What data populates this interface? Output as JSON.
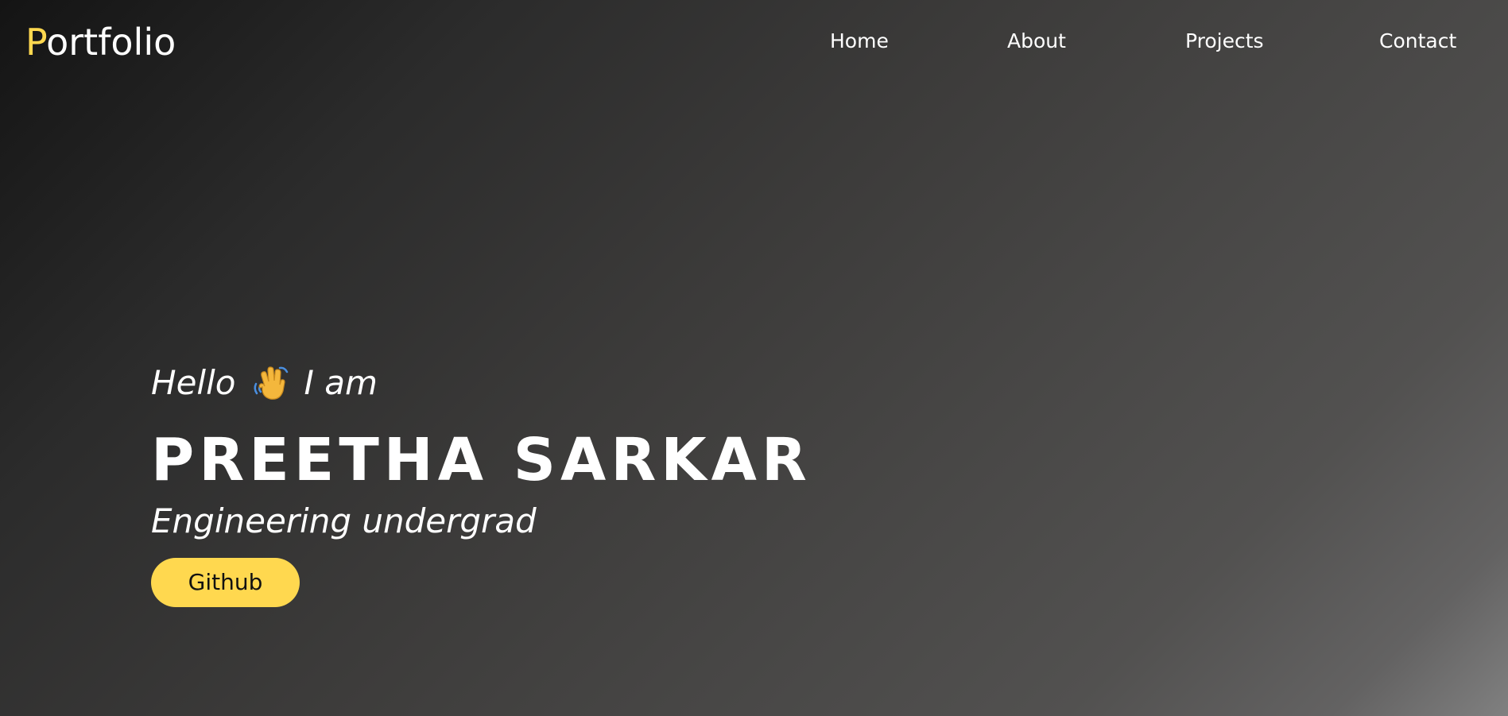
{
  "header": {
    "logo_accent": "P",
    "logo_rest": "ortfolio",
    "nav": {
      "home": "Home",
      "about": "About",
      "projects": "Projects",
      "contact": "Contact"
    }
  },
  "hero": {
    "greeting_before": "Hello",
    "greeting_icon": "waving-hand-icon",
    "greeting_after": "I am",
    "name": "PREETHA SARKAR",
    "subtitle": "Engineering undergrad",
    "github_label": "Github"
  },
  "colors": {
    "accent": "#ffd84f",
    "text": "#ffffff",
    "background_dark": "#141414",
    "background_light": "#808080"
  }
}
